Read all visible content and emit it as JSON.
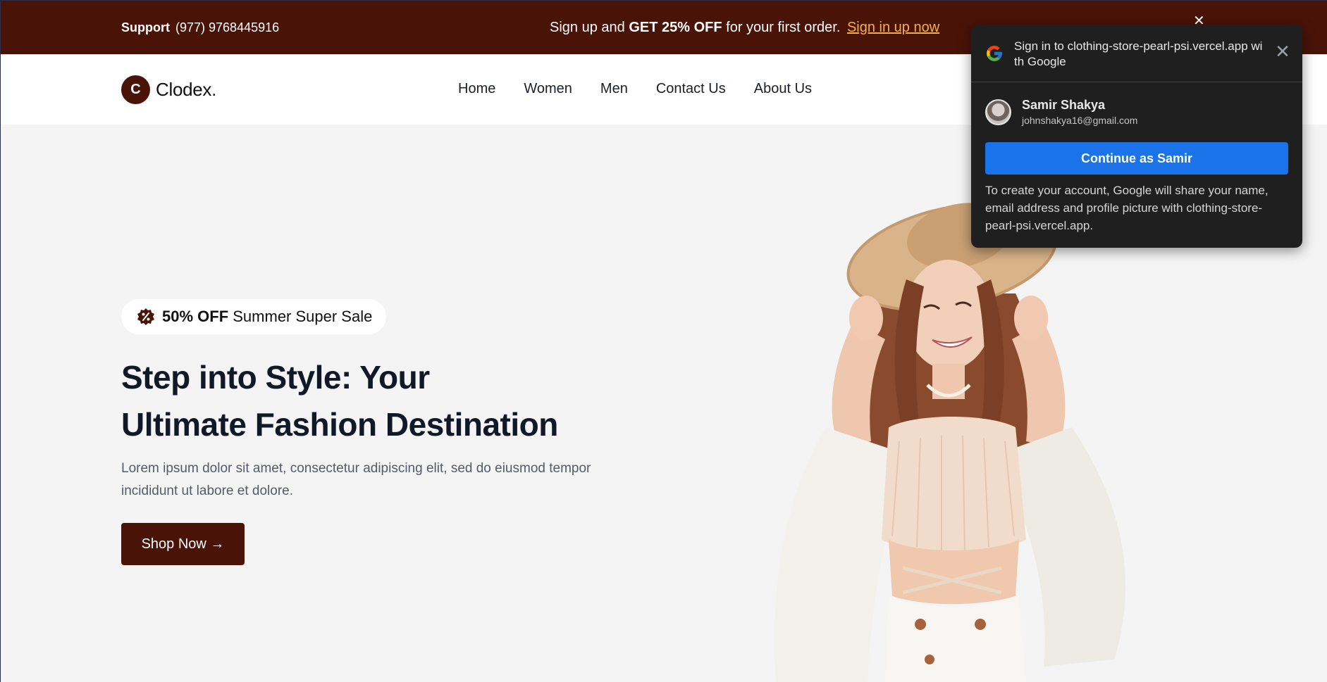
{
  "topbar": {
    "support_label": "Support",
    "support_phone": "(977)  9768445916",
    "promo_prefix": "Sign up and ",
    "promo_bold": "GET 25% OFF",
    "promo_suffix": " for your first order. ",
    "promo_link": "Sign in up now",
    "bg_color": "#4a1308",
    "link_color": "#f3b04a"
  },
  "navbar": {
    "logo_letter": "C",
    "logo_text": "Clodex",
    "logo_dot": ".",
    "links": [
      {
        "label": "Home"
      },
      {
        "label": "Women"
      },
      {
        "label": "Men"
      },
      {
        "label": "Contact Us"
      },
      {
        "label": "About Us"
      }
    ]
  },
  "hero": {
    "badge_bold": "50% OFF",
    "badge_text": " Summer Super Sale",
    "badge_icon": "discount-badge-icon",
    "title_line1": "Step into Style: Your",
    "title_line2": "Ultimate Fashion Destination",
    "description": "Lorem ipsum dolor sit amet, consectetur adipiscing elit, sed do eiusmod tempor incididunt ut labore et dolore.",
    "cta_label": "Shop Now →",
    "accent_color": "#4a1308"
  },
  "google_popup": {
    "title": "Sign in to clothing-store-pearl-psi.vercel.app with Google",
    "account_name": "Samir Shakya",
    "account_email": "johnshakya16@gmail.com",
    "continue_label": "Continue as Samir",
    "disclaimer": "To create your account, Google will share your name, email address and profile picture with clothing-store-pearl-psi.vercel.app.",
    "button_color": "#1a73e8",
    "bg_color": "#1f1f1f"
  }
}
